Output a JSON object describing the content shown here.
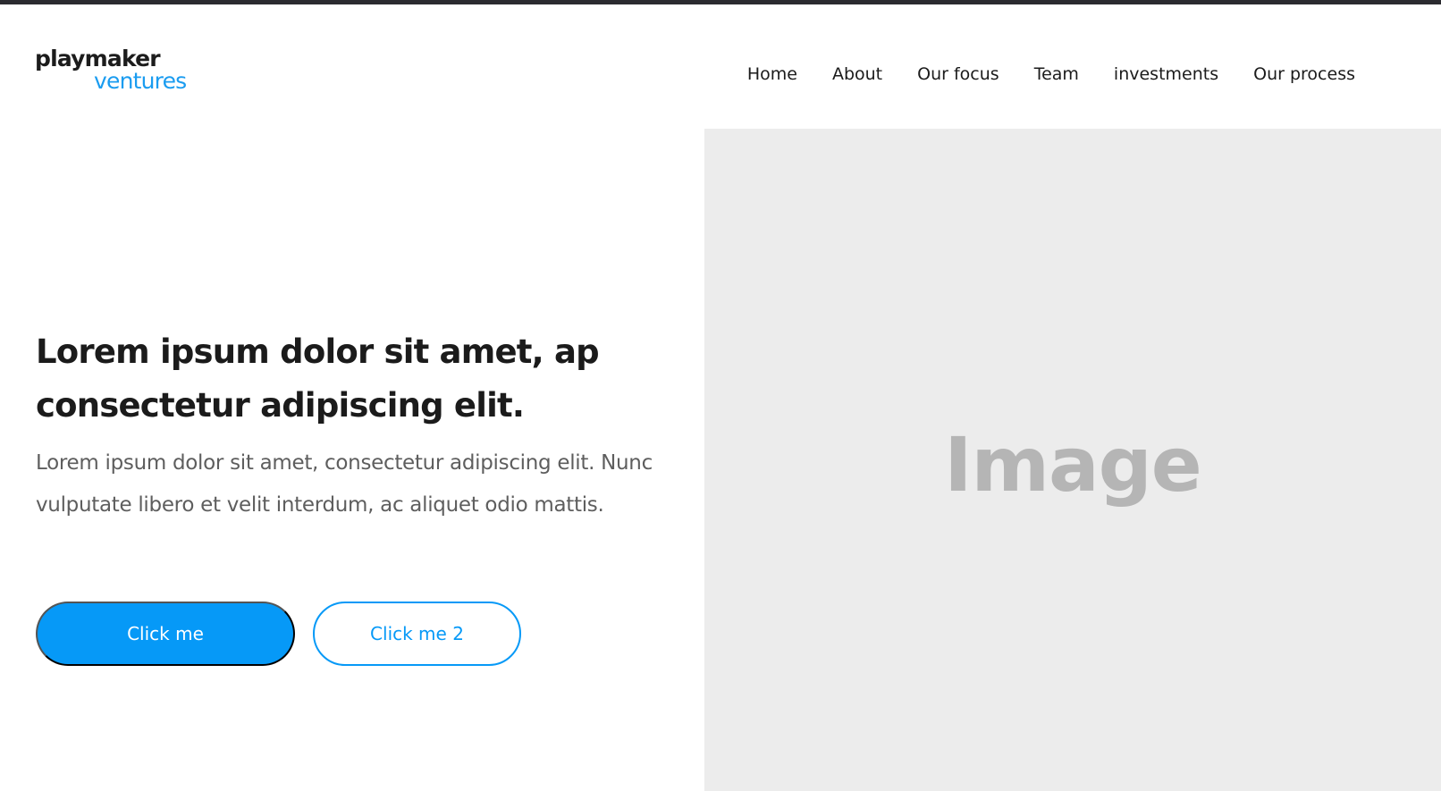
{
  "brand": {
    "line1": "playmaker",
    "line2": "ventures",
    "primary_color": "#1c1c1c",
    "accent_color": "#1a9cf0"
  },
  "nav": {
    "items": [
      {
        "label": "Home"
      },
      {
        "label": "About"
      },
      {
        "label": "Our focus"
      },
      {
        "label": "Team"
      },
      {
        "label": "investments"
      },
      {
        "label": "Our process"
      }
    ]
  },
  "hero": {
    "title": "Lorem ipsum dolor sit amet, ap consectetur adipiscing elit.",
    "body": "Lorem ipsum dolor sit amet, consectetur adipiscing elit. Nunc vulputate libero et velit interdum, ac aliquet odio mattis.",
    "primary_button": "Click me",
    "secondary_button": "Click me 2",
    "button_color": "#0699f7"
  },
  "image_placeholder": {
    "label": "Image",
    "background": "#ececec"
  }
}
